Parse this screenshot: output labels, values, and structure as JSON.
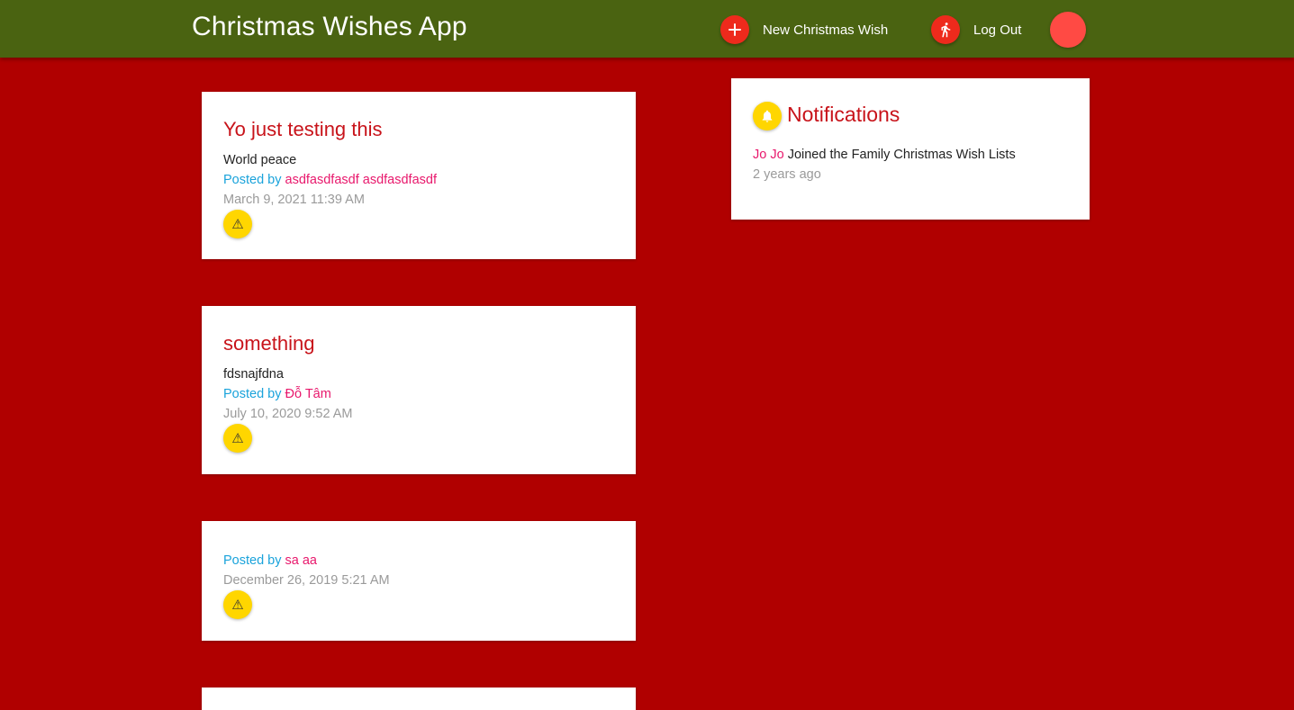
{
  "colors": {
    "header_bg": "#4a6311",
    "page_bg": "#b00000",
    "accent_red": "#ee2a1c",
    "avatar_red": "#ff4a44",
    "warn_yellow": "#ffd600",
    "title_red": "#c8131a",
    "link_blue": "#1aa3db",
    "author_pink": "#e8186c",
    "meta_gray": "#9a9a9a",
    "body_text": "#222222"
  },
  "header": {
    "title": "Christmas Wishes App",
    "new_wish_label": "New Christmas Wish",
    "new_wish_icon": "plus-icon",
    "logout_label": "Log Out",
    "logout_icon": "running-person-icon"
  },
  "wishes": [
    {
      "title": "Yo just testing this",
      "description": "World peace",
      "posted_by_prefix": "Posted by ",
      "author": "asdfasdfasdf asdfasdfasdf",
      "date": "March 9, 2021 11:39 AM",
      "report_icon": "warning-icon"
    },
    {
      "title": "something",
      "description": "fdsnajfdna",
      "posted_by_prefix": "Posted by ",
      "author": "Đỗ Tâm",
      "date": "July 10, 2020 9:52 AM",
      "report_icon": "warning-icon"
    },
    {
      "title": "",
      "description": "",
      "posted_by_prefix": "Posted by ",
      "author": "sa aa",
      "date": "December 26, 2019 5:21 AM",
      "report_icon": "warning-icon"
    }
  ],
  "notifications": {
    "heading": "Notifications",
    "icon": "bell-icon",
    "items": [
      {
        "user": "Jo Jo",
        "text": " Joined the Family Christmas Wish Lists",
        "time": "2 years ago"
      }
    ]
  }
}
